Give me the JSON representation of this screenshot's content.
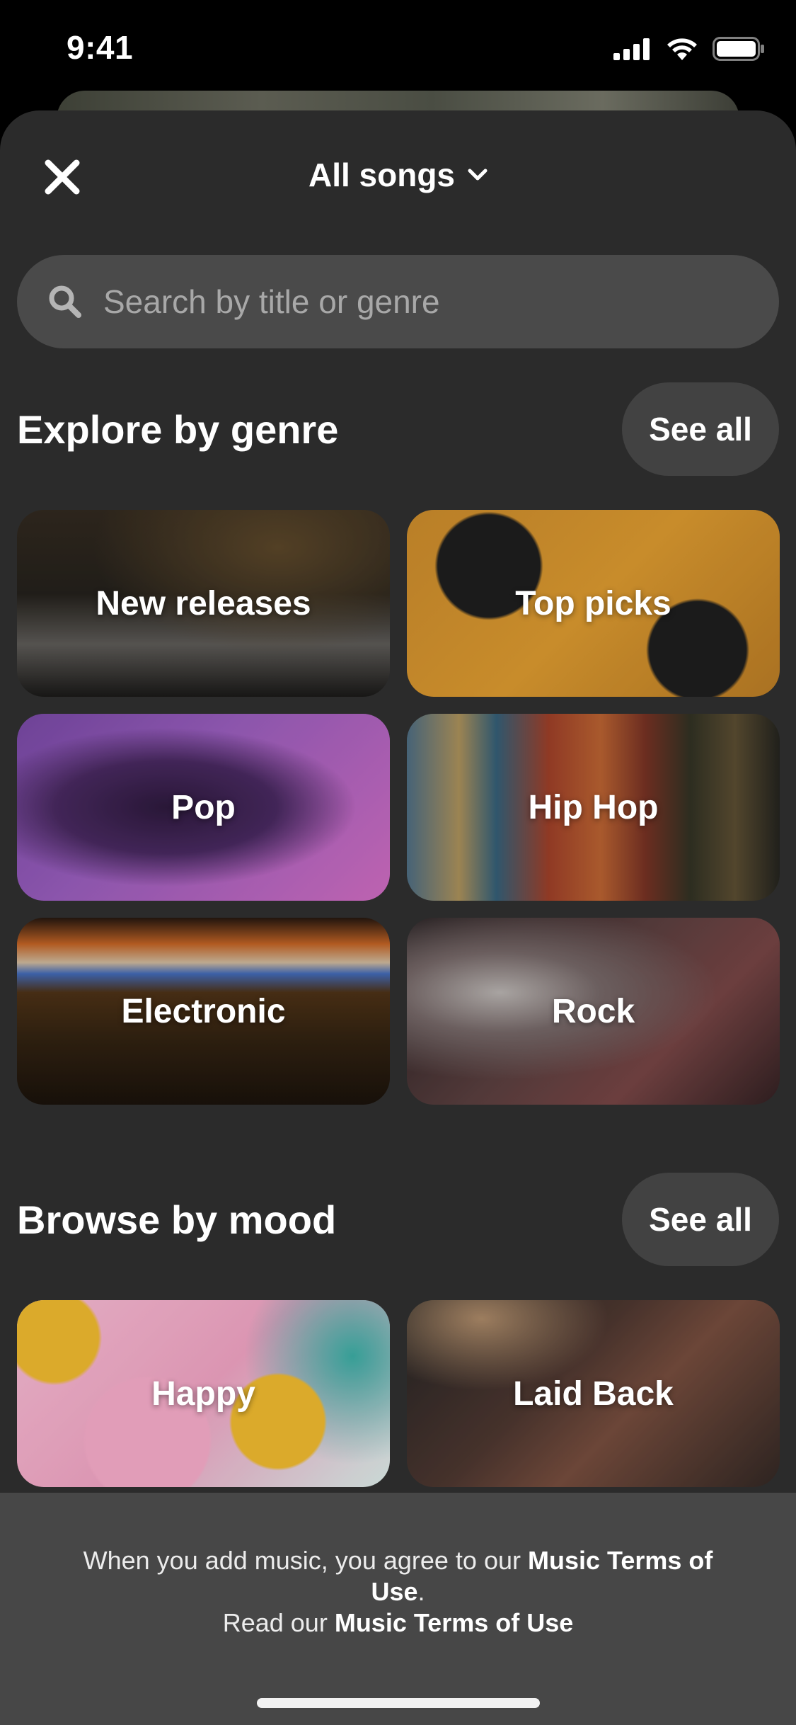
{
  "status_bar": {
    "time": "9:41"
  },
  "header": {
    "title": "All songs",
    "close_icon": "close-icon",
    "dropdown_icon": "chevron-down-icon"
  },
  "search": {
    "placeholder": "Search by title or genre",
    "value": "",
    "icon": "search-icon"
  },
  "genres": {
    "title": "Explore by genre",
    "see_all": "See all",
    "items": [
      {
        "label": "New releases"
      },
      {
        "label": "Top picks"
      },
      {
        "label": "Pop"
      },
      {
        "label": "Hip Hop"
      },
      {
        "label": "Electronic"
      },
      {
        "label": "Rock"
      }
    ]
  },
  "moods": {
    "title": "Browse by mood",
    "see_all": "See all",
    "items": [
      {
        "label": "Happy"
      },
      {
        "label": "Laid Back"
      }
    ]
  },
  "footer": {
    "line1_prefix": "When you add music, you agree to our ",
    "line1_link": "Music Terms of Use",
    "line1_suffix": ".",
    "line2_prefix": "Read our ",
    "line2_link": "Music Terms of Use"
  },
  "colors": {
    "sheet_bg": "#2b2b2b",
    "search_bg": "#4a4a4a",
    "pill_bg": "#424242",
    "footer_bg": "#474747"
  }
}
